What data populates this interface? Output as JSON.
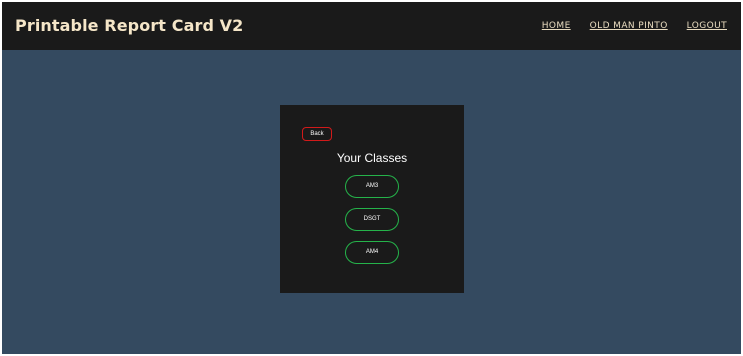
{
  "header": {
    "brand": "Printable Report Card V2",
    "nav": [
      {
        "label": "HOME"
      },
      {
        "label": "OLD MAN PINTO"
      },
      {
        "label": "LOGOUT"
      }
    ]
  },
  "panel": {
    "back_label": "Back",
    "title": "Your Classes",
    "classes": [
      {
        "label": "AM3"
      },
      {
        "label": "DSGT"
      },
      {
        "label": "AM4"
      }
    ]
  },
  "colors": {
    "navbar_bg": "#1a1a1a",
    "page_bg": "#344a60",
    "brand_text": "#f5e6c8",
    "back_border": "#d21a1a",
    "class_border": "#25b34a"
  }
}
